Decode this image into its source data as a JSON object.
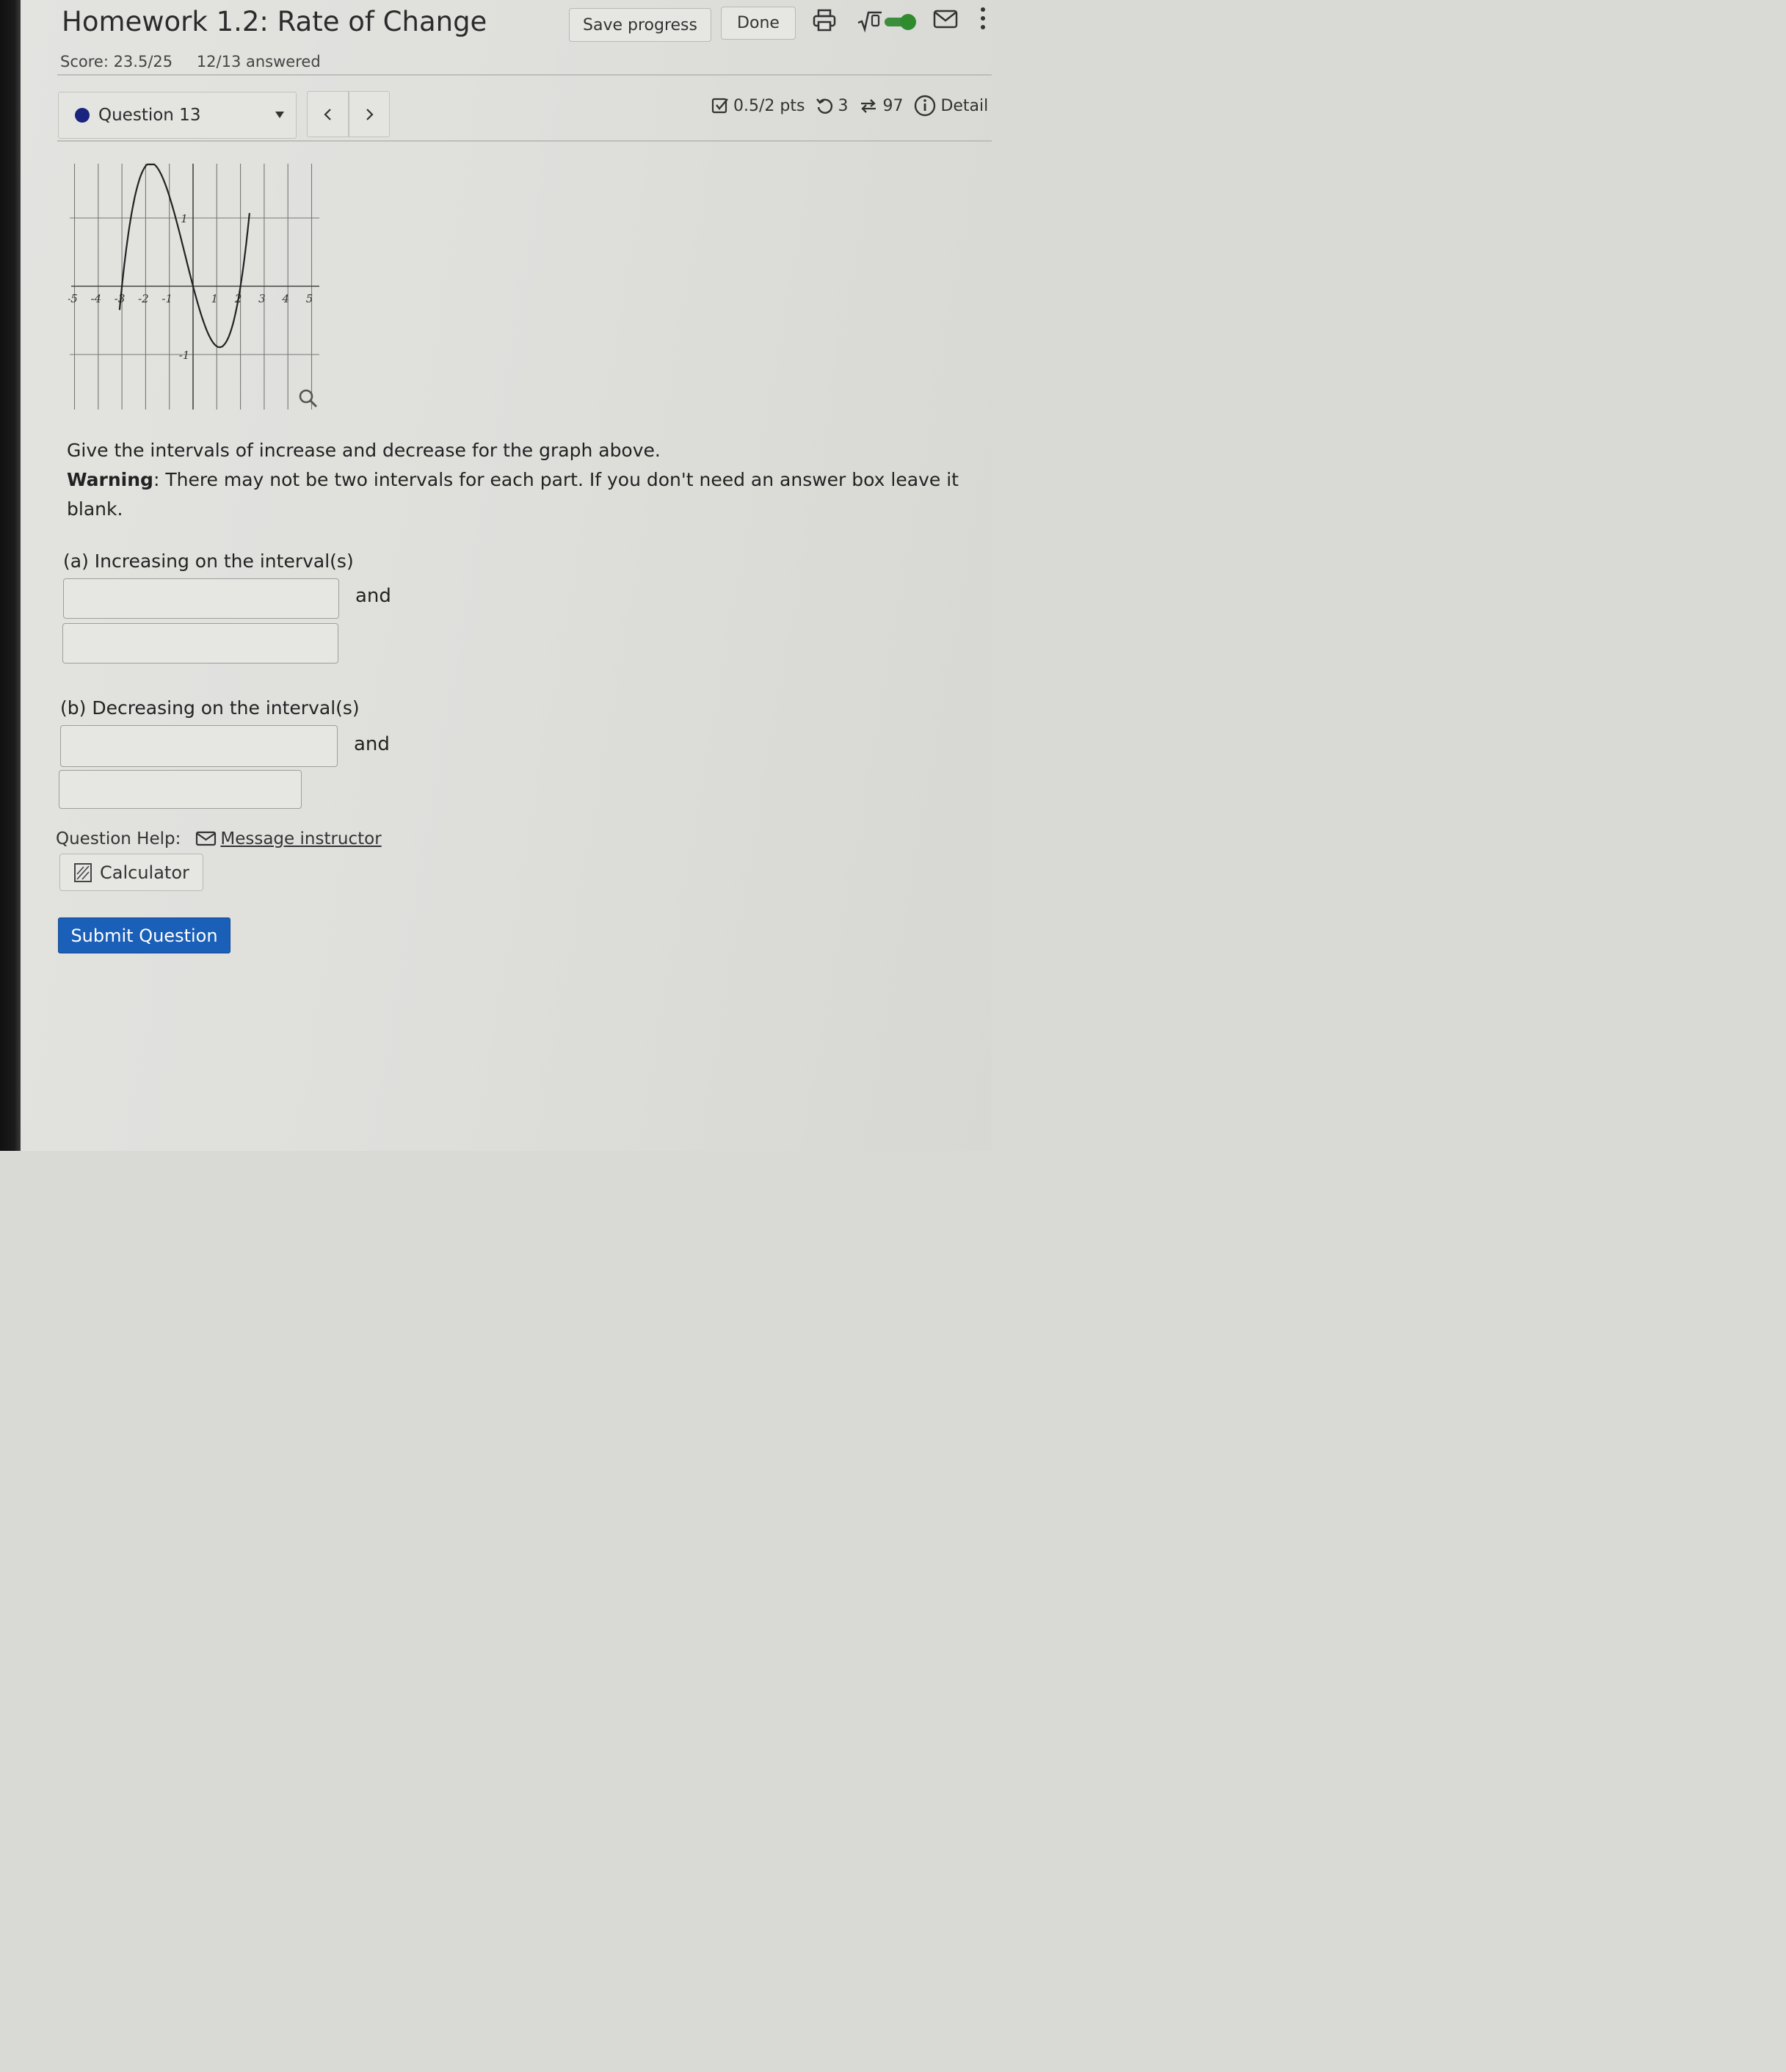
{
  "header": {
    "title": "Homework 1.2: Rate of Change",
    "save_label": "Save progress",
    "done_label": "Done",
    "score": "Score: 23.5/25",
    "answered": "12/13 answered",
    "icons": [
      "printer-icon",
      "math-sqrt-toggle-icon",
      "mail-icon",
      "more-vertical-icon"
    ]
  },
  "question_nav": {
    "selected": "Question 13",
    "prev_icon": "chevron-left-icon",
    "next_icon": "chevron-right-icon",
    "points": "0.5/2 pts",
    "retries": "3",
    "attempts": "97",
    "details_label": "Detail"
  },
  "graph": {
    "x_ticks": [
      "-5",
      "-4",
      "-3",
      "-2",
      "-1",
      "1",
      "2",
      "3",
      "4",
      "5"
    ],
    "y_ticks": [
      "1",
      "-1"
    ],
    "zoom_icon": "magnifier-icon"
  },
  "prompt": {
    "line1": "Give the intervals of increase and decrease for the graph above.",
    "warning_label": "Warning",
    "warning_text": ": There may not be two intervals for each part. If you don't need an answer box leave it blank."
  },
  "part_a": {
    "label": "(a) Increasing on the interval(s)",
    "and": "and",
    "value1": "",
    "value2": ""
  },
  "part_b": {
    "label": "(b) Decreasing on the interval(s)",
    "and": "and",
    "value1": "",
    "value2": ""
  },
  "help": {
    "label": "Question Help:",
    "message_link": "Message instructor",
    "calculator": "Calculator"
  },
  "submit_label": "Submit Question"
}
